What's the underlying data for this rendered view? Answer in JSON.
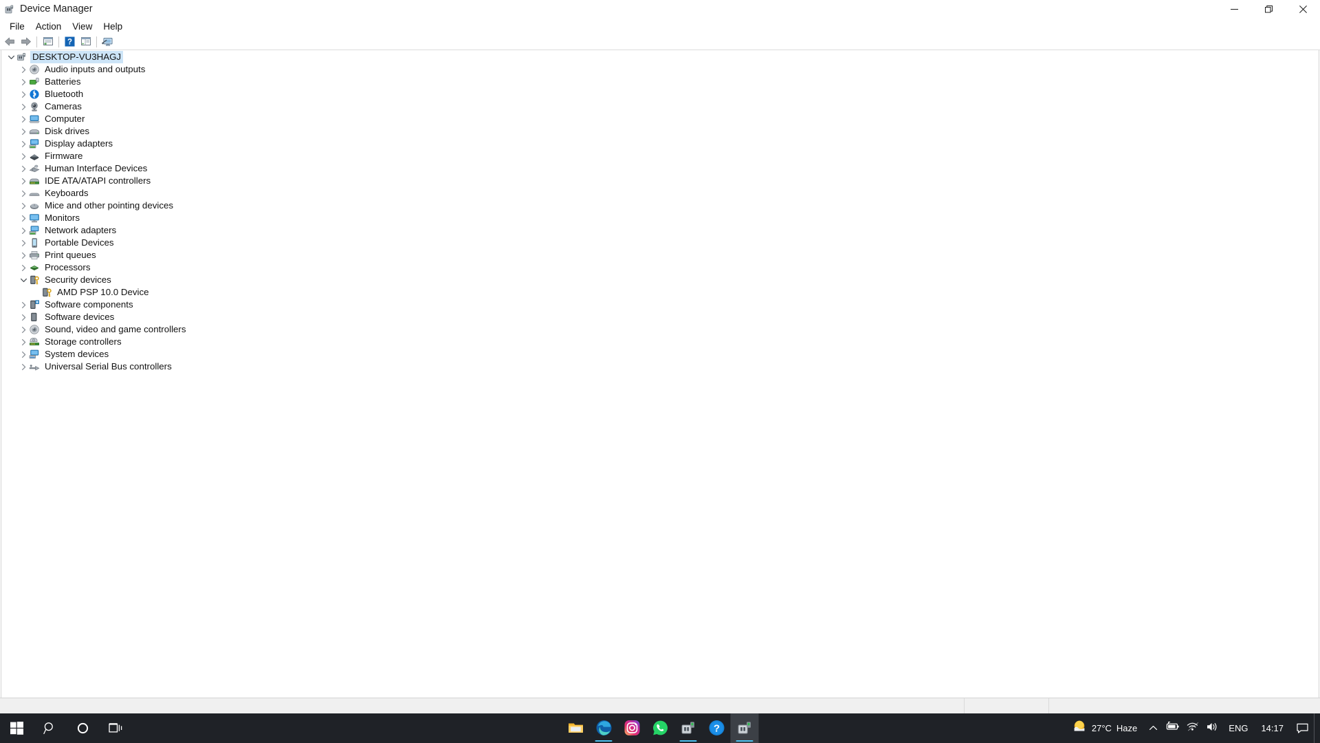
{
  "window": {
    "title": "Device Manager",
    "icon": "device-manager-icon",
    "controls": {
      "minimize": "minimize-button",
      "restore": "restore-button",
      "close": "close-button"
    }
  },
  "menubar": {
    "items": [
      {
        "label": "File",
        "name": "menu-file"
      },
      {
        "label": "Action",
        "name": "menu-action"
      },
      {
        "label": "View",
        "name": "menu-view"
      },
      {
        "label": "Help",
        "name": "menu-help"
      }
    ]
  },
  "toolbar": {
    "buttons": [
      {
        "name": "back-button",
        "icon": "back-arrow-icon"
      },
      {
        "name": "forward-button",
        "icon": "forward-arrow-icon"
      },
      {
        "name": "separator-1",
        "icon": "separator"
      },
      {
        "name": "properties-button",
        "icon": "properties-icon"
      },
      {
        "name": "separator-2",
        "icon": "separator"
      },
      {
        "name": "help-button",
        "icon": "help-question-icon"
      },
      {
        "name": "show-hide-console-tree-button",
        "icon": "console-tree-icon"
      },
      {
        "name": "separator-3",
        "icon": "separator"
      },
      {
        "name": "scan-for-hardware-changes-button",
        "icon": "scan-monitor-icon"
      }
    ]
  },
  "tree": {
    "root": {
      "label": "DESKTOP-VU3HAGJ",
      "icon": "computer-root-icon",
      "expanded": true,
      "selected": true
    },
    "items": [
      {
        "label": "Audio inputs and outputs",
        "icon": "speaker-icon",
        "expanded": false,
        "depth": 1
      },
      {
        "label": "Batteries",
        "icon": "battery-icon",
        "expanded": false,
        "depth": 1
      },
      {
        "label": "Bluetooth",
        "icon": "bluetooth-icon",
        "expanded": false,
        "depth": 1
      },
      {
        "label": "Cameras",
        "icon": "camera-icon",
        "expanded": false,
        "depth": 1
      },
      {
        "label": "Computer",
        "icon": "computer-icon",
        "expanded": false,
        "depth": 1
      },
      {
        "label": "Disk drives",
        "icon": "disk-drive-icon",
        "expanded": false,
        "depth": 1
      },
      {
        "label": "Display adapters",
        "icon": "display-adapter-icon",
        "expanded": false,
        "depth": 1
      },
      {
        "label": "Firmware",
        "icon": "firmware-icon",
        "expanded": false,
        "depth": 1
      },
      {
        "label": "Human Interface Devices",
        "icon": "hid-icon",
        "expanded": false,
        "depth": 1
      },
      {
        "label": "IDE ATA/ATAPI controllers",
        "icon": "ide-controller-icon",
        "expanded": false,
        "depth": 1
      },
      {
        "label": "Keyboards",
        "icon": "keyboard-icon",
        "expanded": false,
        "depth": 1
      },
      {
        "label": "Mice and other pointing devices",
        "icon": "mouse-icon",
        "expanded": false,
        "depth": 1
      },
      {
        "label": "Monitors",
        "icon": "monitor-icon",
        "expanded": false,
        "depth": 1
      },
      {
        "label": "Network adapters",
        "icon": "network-adapter-icon",
        "expanded": false,
        "depth": 1
      },
      {
        "label": "Portable Devices",
        "icon": "portable-device-icon",
        "expanded": false,
        "depth": 1
      },
      {
        "label": "Print queues",
        "icon": "printer-icon",
        "expanded": false,
        "depth": 1
      },
      {
        "label": "Processors",
        "icon": "processor-icon",
        "expanded": false,
        "depth": 1
      },
      {
        "label": "Security devices",
        "icon": "security-device-icon",
        "expanded": true,
        "depth": 1
      },
      {
        "label": "AMD PSP 10.0 Device",
        "icon": "security-device-icon",
        "expanded": null,
        "depth": 2
      },
      {
        "label": "Software components",
        "icon": "software-component-icon",
        "expanded": false,
        "depth": 1
      },
      {
        "label": "Software devices",
        "icon": "software-device-icon",
        "expanded": false,
        "depth": 1
      },
      {
        "label": "Sound, video and game controllers",
        "icon": "speaker-icon",
        "expanded": false,
        "depth": 1
      },
      {
        "label": "Storage controllers",
        "icon": "storage-controller-icon",
        "expanded": false,
        "depth": 1
      },
      {
        "label": "System devices",
        "icon": "system-device-icon",
        "expanded": false,
        "depth": 1
      },
      {
        "label": "Universal Serial Bus controllers",
        "icon": "usb-controller-icon",
        "expanded": false,
        "depth": 1
      }
    ]
  },
  "statusbar": {
    "pane1": "",
    "pane2": "",
    "pane3": ""
  },
  "taskbar": {
    "system_buttons": [
      {
        "name": "start-button",
        "icon": "windows-logo-icon"
      },
      {
        "name": "search-button",
        "icon": "search-icon"
      },
      {
        "name": "cortana-button",
        "icon": "cortana-circle-icon"
      },
      {
        "name": "task-view-button",
        "icon": "task-view-icon"
      }
    ],
    "apps": [
      {
        "name": "taskbar-file-explorer",
        "icon": "file-explorer-icon",
        "running": false,
        "active": false
      },
      {
        "name": "taskbar-microsoft-edge",
        "icon": "edge-icon",
        "running": true,
        "active": false
      },
      {
        "name": "taskbar-instagram",
        "icon": "instagram-icon",
        "running": false,
        "active": false
      },
      {
        "name": "taskbar-whatsapp",
        "icon": "whatsapp-icon",
        "running": false,
        "active": false
      },
      {
        "name": "taskbar-device-manager-1",
        "icon": "device-manager-icon",
        "running": true,
        "active": false
      },
      {
        "name": "taskbar-get-help",
        "icon": "help-question-icon",
        "running": false,
        "active": false
      },
      {
        "name": "taskbar-device-manager-active",
        "icon": "device-manager-icon",
        "running": true,
        "active": true
      }
    ],
    "tray": {
      "weather_temp": "27°C",
      "weather_condition": "Haze",
      "weather_icon": "sun-haze-icon",
      "overflow_icon": "chevron-up-icon",
      "battery_icon": "battery-icon",
      "network_icon": "wifi-icon",
      "volume_icon": "speaker-volume-icon",
      "language": "ENG",
      "clock": "14:17",
      "notification_icon": "notification-icon"
    }
  }
}
